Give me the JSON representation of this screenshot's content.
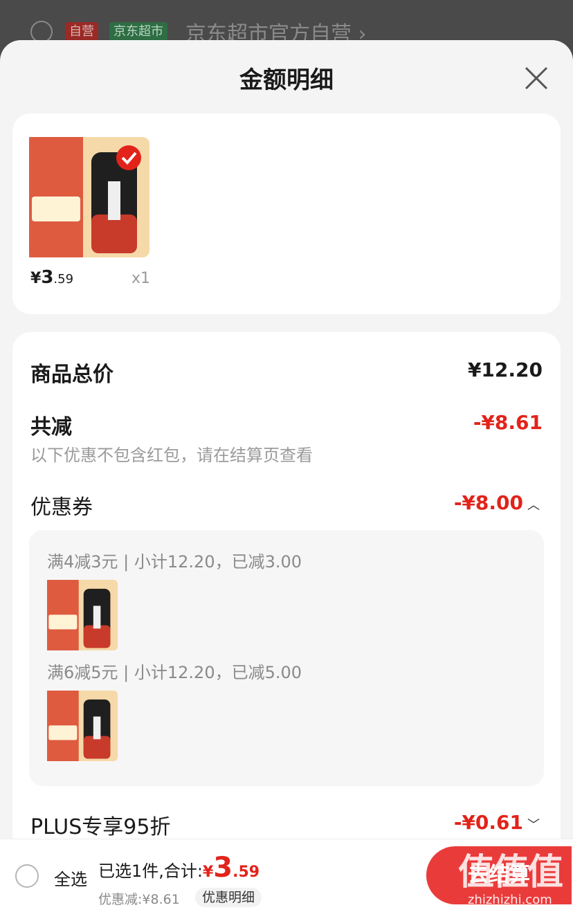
{
  "background": {
    "tag_self": "自营",
    "tag_market": "京东超市",
    "store_name": "京东超市官方自营 ›"
  },
  "sheet": {
    "title": "金额明细"
  },
  "product": {
    "price_yen": "¥",
    "price_int": "3",
    "price_dec": ".59",
    "quantity": "x1"
  },
  "summary_card": {
    "total_label": "商品总价",
    "total_value": "¥12.20",
    "reduce_label": "共减",
    "reduce_value": "-¥8.61",
    "note": "以下优惠不包含红包，请在结算页查看",
    "coupon_label": "优惠券",
    "coupon_value": "-¥8.00",
    "coupons": [
      {
        "text": "满4减3元 | 小计12.20，已减3.00"
      },
      {
        "text": "满6减5元 | 小计12.20，已减5.00"
      }
    ],
    "plus_label": "PLUS专享95折",
    "plus_value": "-¥0.61"
  },
  "bottom_bar": {
    "select_all": "全选",
    "selected_text": "已选1件,合计:",
    "total_yen": "¥",
    "total_int": "3",
    "total_dec": ".59",
    "discount_text": "优惠减:¥8.61",
    "detail_button": "优惠明细",
    "checkout_button": "去结算"
  },
  "watermark": {
    "text": "值值值",
    "url": "zhizhizhi.com"
  },
  "colors": {
    "accent_red": "#e2231a",
    "checkout_red": "#ea3b3b",
    "sheet_bg": "#f4f4f4"
  },
  "icons": {
    "close": "close-icon",
    "check": "check-icon",
    "chevron_up": "chevron-up-icon",
    "chevron_down": "chevron-down-icon"
  }
}
